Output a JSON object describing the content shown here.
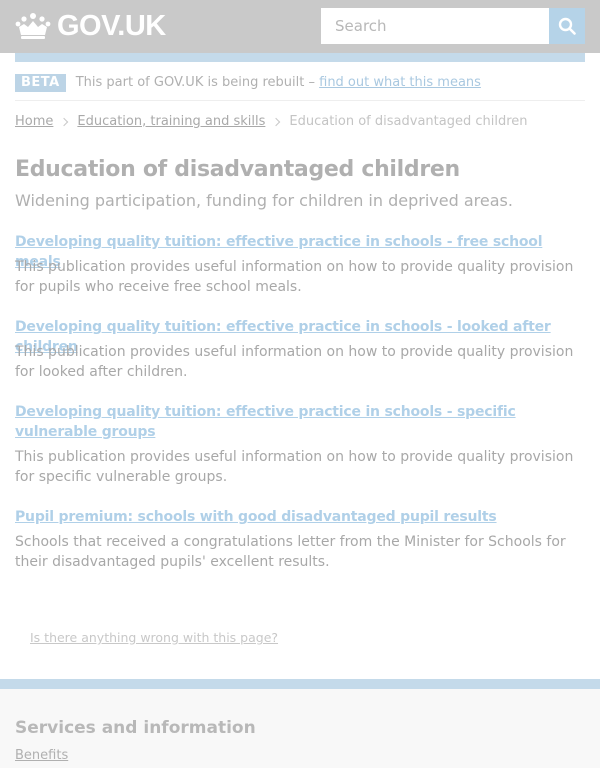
{
  "header": {
    "logo_text": "GOV.UK",
    "search_placeholder": "Search",
    "colors": {
      "header_bg": "#c9c9c9",
      "accent_blue": "#c4daea"
    }
  },
  "phase_banner": {
    "tag": "BETA",
    "text": "This part of GOV.UK is being rebuilt –",
    "link": "find out what this means"
  },
  "breadcrumbs": {
    "home": "Home",
    "section": "Education, training and skills",
    "current": "Education of disadvantaged children"
  },
  "page": {
    "title": "Education of disadvantaged children",
    "subtitle": "Widening participation, funding for children in deprived areas."
  },
  "items": [
    {
      "title": "Developing quality tuition: effective practice in schools - free school meals",
      "description": "This publication provides useful information on how to provide quality provision for pupils who receive free school meals."
    },
    {
      "title": "Developing quality tuition: effective practice in schools - looked after children",
      "description": "This publication provides useful information on how to provide quality provision for looked after children."
    },
    {
      "title": "Developing quality tuition: effective practice in schools - specific vulnerable groups",
      "description": "This publication provides useful information on how to provide quality provision for specific vulnerable groups."
    },
    {
      "title": "Pupil premium: schools with good disadvantaged pupil results",
      "description": "Schools that received a congratulations letter from the Minister for Schools for their disadvantaged pupils' excellent results."
    }
  ],
  "report_link": "Is there anything wrong with this page?",
  "footer": {
    "heading": "Services and information",
    "link": "Benefits"
  }
}
